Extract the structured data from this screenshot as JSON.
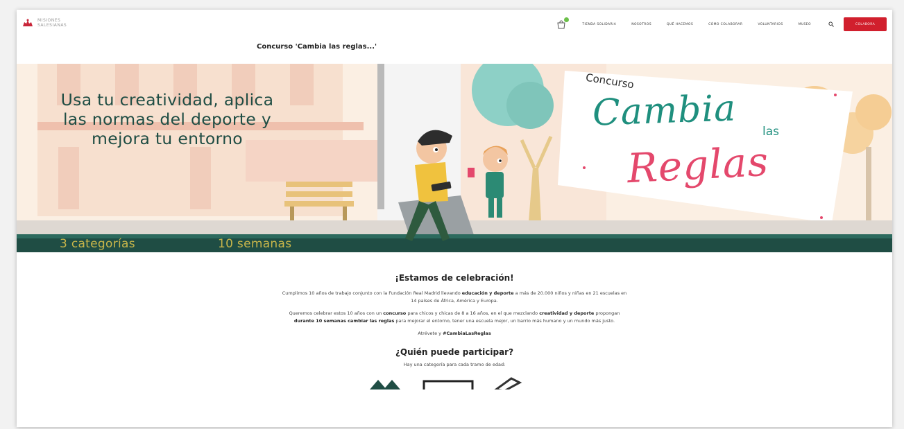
{
  "header": {
    "logo_text": "Misiones Salesianas",
    "nav": [
      "Tienda solidaria",
      "Nosotros",
      "Qué hacemos",
      "Cómo colaborar",
      "Voluntarios",
      "Museo"
    ],
    "donate_label": "Colabora"
  },
  "page_title": "Concurso 'Cambia las reglas...'",
  "hero": {
    "headline": "Usa tu creatividad, aplica las normas del deporte y mejora tu entorno",
    "badge": {
      "concurso": "Concurso",
      "cambia": "Cambia",
      "las": "las",
      "reglas": "Reglas"
    },
    "stats": [
      "3 categorías",
      "10 semanas"
    ]
  },
  "content": {
    "celebration_heading": "¡Estamos de celebración!",
    "p1": {
      "a": "Cumplimos 10 años de trabajo conjunto con la Fundación Real Madrid llevando",
      "b_bold": "educación y deporte",
      "c": "a más de 20.000 niños y niñas en 21 escuelas en 14 países de África, América y Europa."
    },
    "p2": {
      "a": "Queremos celebrar estos 10 años con un",
      "b_bold": "concurso",
      "c": "para chicos y chicas de 8 a 16 años, en el que mezclando",
      "d_bold": "creatividad y deporte",
      "e": "propongan",
      "f_bold": "durante 10 semanas cambiar las reglas",
      "g": "para mejorar el entorno, tener una escuela mejor, un barrio más humano y un mundo más justo."
    },
    "p3": {
      "a": "Atrévete y",
      "b_bold": "#CambiaLasReglas"
    },
    "who_heading": "¿Quién puede participar?",
    "who_text": "Hay una categoría para cada tramo de edad:"
  },
  "colors": {
    "accent_red": "#d11f2d",
    "hero_teal": "#1f4d44",
    "badge_teal": "#1f8f7e",
    "badge_pink": "#e4486c",
    "cart_badge": "#6cc04a"
  },
  "icons": [
    "logo-icon",
    "cart-icon",
    "search-icon"
  ]
}
